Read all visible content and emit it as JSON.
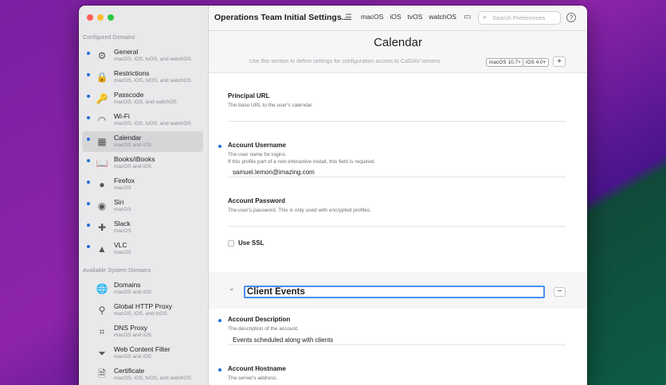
{
  "window": {
    "title": "Operations Team Initial Settings....",
    "platforms": [
      "macOS",
      "iOS",
      "tvOS",
      "watchOS"
    ],
    "search_placeholder": "Search Preferences",
    "help_label": "?"
  },
  "sidebar": {
    "configured_title": "Configured Domains",
    "configured": [
      {
        "name": "General",
        "sub": "macOS, iOS, tvOS, and watchOS",
        "icon": "sliders-icon",
        "glyph": "⚙"
      },
      {
        "name": "Restrictions",
        "sub": "macOS, iOS, tvOS, and watchOS",
        "icon": "lock-icon",
        "glyph": "🔒"
      },
      {
        "name": "Passcode",
        "sub": "macOS, iOS, and watchOS",
        "icon": "key-icon",
        "glyph": "🔑"
      },
      {
        "name": "Wi-Fi",
        "sub": "macOS, iOS, tvOS, and watchOS",
        "icon": "wifi-icon",
        "glyph": "◠"
      },
      {
        "name": "Calendar",
        "sub": "macOS and iOS",
        "icon": "calendar-icon",
        "glyph": "▦"
      },
      {
        "name": "Books/iBooks",
        "sub": "macOS and iOS",
        "icon": "books-icon",
        "glyph": "📖"
      },
      {
        "name": "Firefox",
        "sub": "macOS",
        "icon": "firefox-icon",
        "glyph": "●"
      },
      {
        "name": "Siri",
        "sub": "macOS",
        "icon": "siri-icon",
        "glyph": "◉"
      },
      {
        "name": "Slack",
        "sub": "macOS",
        "icon": "slack-icon",
        "glyph": "✚"
      },
      {
        "name": "VLC",
        "sub": "macOS",
        "icon": "vlc-cone-icon",
        "glyph": "▲"
      }
    ],
    "available_title": "Available System Domains",
    "available": [
      {
        "name": "Domains",
        "sub": "macOS and iOS",
        "icon": "globe-icon",
        "glyph": "🌐"
      },
      {
        "name": "Global HTTP Proxy",
        "sub": "macOS, iOS, and tvOS",
        "icon": "proxy-icon",
        "glyph": "⚲"
      },
      {
        "name": "DNS Proxy",
        "sub": "macOS and iOS",
        "icon": "dns-icon",
        "glyph": "⌗"
      },
      {
        "name": "Web Content Filter",
        "sub": "macOS and iOS",
        "icon": "filter-icon",
        "glyph": "⏷"
      },
      {
        "name": "Certificate",
        "sub": "macOS, iOS, tvOS, and watchOS",
        "icon": "certificate-icon",
        "glyph": "🗎"
      }
    ]
  },
  "main": {
    "title": "Calendar",
    "description": "Use this section to define settings for configuration access to CalDAV servers.",
    "badges": [
      "macOS 10.7+",
      "iOS 4.0+"
    ],
    "add_label": "+",
    "fields": {
      "principal_url": {
        "label": "Principal URL",
        "desc": "The base URL to the user's calendar.",
        "value": ""
      },
      "account_username": {
        "label": "Account Username",
        "desc1": "The user name for logins.",
        "desc2": "If this profile part of a non-interactive install, this field is required.",
        "value": "samuel.lemon@imazing.com"
      },
      "account_password": {
        "label": "Account Password",
        "desc": "The user's password. This is only used with encrypted profiles.",
        "value": ""
      },
      "use_ssl": {
        "label": "Use SSL"
      }
    },
    "payload_name": "Client Events",
    "remove_label": "−",
    "fields2": {
      "account_description": {
        "label": "Account Description",
        "desc": "The description of the account.",
        "value": "Events scheduled along with clients"
      },
      "account_hostname": {
        "label": "Account Hostname",
        "desc": "The server's address."
      }
    }
  }
}
